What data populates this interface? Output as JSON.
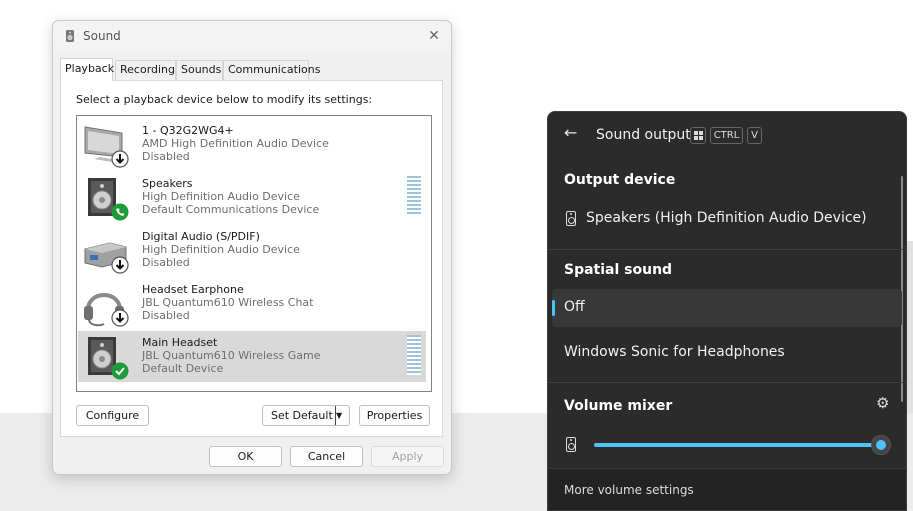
{
  "dialog": {
    "title": "Sound",
    "tabs": [
      {
        "label": "Playback"
      },
      {
        "label": "Recording"
      },
      {
        "label": "Sounds"
      },
      {
        "label": "Communications"
      }
    ],
    "instruction": "Select a playback device below to modify its settings:",
    "devices": [
      {
        "name": "1 - Q32G2WG4+",
        "driver": "AMD High Definition Audio Device",
        "status": "Disabled",
        "icon": "monitor-icon",
        "badge": "disabled-arrow-icon"
      },
      {
        "name": "Speakers",
        "driver": "High Definition Audio Device",
        "status": "Default Communications Device",
        "icon": "speaker-icon",
        "badge": "phone-badge-icon"
      },
      {
        "name": "Digital Audio (S/PDIF)",
        "driver": "High Definition Audio Device",
        "status": "Disabled",
        "icon": "digital-output-icon",
        "badge": "disabled-arrow-icon"
      },
      {
        "name": "Headset Earphone",
        "driver": "JBL Quantum610 Wireless Chat",
        "status": "Disabled",
        "icon": "headset-icon",
        "badge": "disabled-arrow-icon"
      },
      {
        "name": "Main Headset",
        "driver": "JBL Quantum610 Wireless Game",
        "status": "Default Device",
        "icon": "speaker-icon",
        "badge": "check-badge-icon"
      }
    ],
    "buttons": {
      "configure": "Configure",
      "set_default": "Set Default",
      "properties": "Properties",
      "ok": "OK",
      "cancel": "Cancel",
      "apply": "Apply"
    }
  },
  "flyout": {
    "title": "Sound output",
    "shortcut_keys": [
      "CTRL",
      "V"
    ],
    "output_device_heading": "Output device",
    "output_device": "Speakers (High Definition Audio Device)",
    "spatial_heading": "Spatial sound",
    "spatial_options": [
      "Off",
      "Windows Sonic for Headphones"
    ],
    "spatial_selected": "Off",
    "mixer_heading": "Volume mixer",
    "volume_level": 1.0,
    "more_settings": "More volume settings",
    "accent_color": "#4cc2ff"
  }
}
